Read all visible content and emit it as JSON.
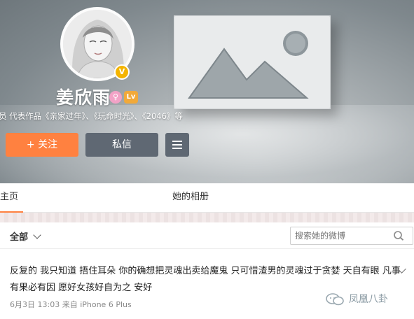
{
  "profile": {
    "name": "姜欣雨",
    "bio": "员 代表作品《亲家过年》、《玩命时光》、《2046》等",
    "verified_symbol": "V",
    "gender_symbol": "♀",
    "level_symbol": "Lv"
  },
  "buttons": {
    "follow_label": "+ 关注",
    "message_label": "私信",
    "more_icon": "menu-icon"
  },
  "tabs": [
    {
      "label": "主页",
      "active": true
    },
    {
      "label": "她的相册",
      "active": false
    }
  ],
  "filter": {
    "selected": "全部",
    "search_placeholder": "搜索她的微博"
  },
  "post": {
    "text": "反复的 我只知道 捂住耳朵 你的确想把灵魂出卖给魔鬼 只可惜渣男的灵魂过于贪婪 天自有眼 凡事有果必有因 愿好女孩好自为之 安好",
    "date": "6月3日",
    "time": "13:03",
    "source": "来自 iPhone 6 Plus"
  },
  "watermark": {
    "text": "凤凰八卦"
  },
  "colors": {
    "accent": "#ff8140",
    "button_dark": "#5f6873",
    "verified": "#f4b400"
  }
}
